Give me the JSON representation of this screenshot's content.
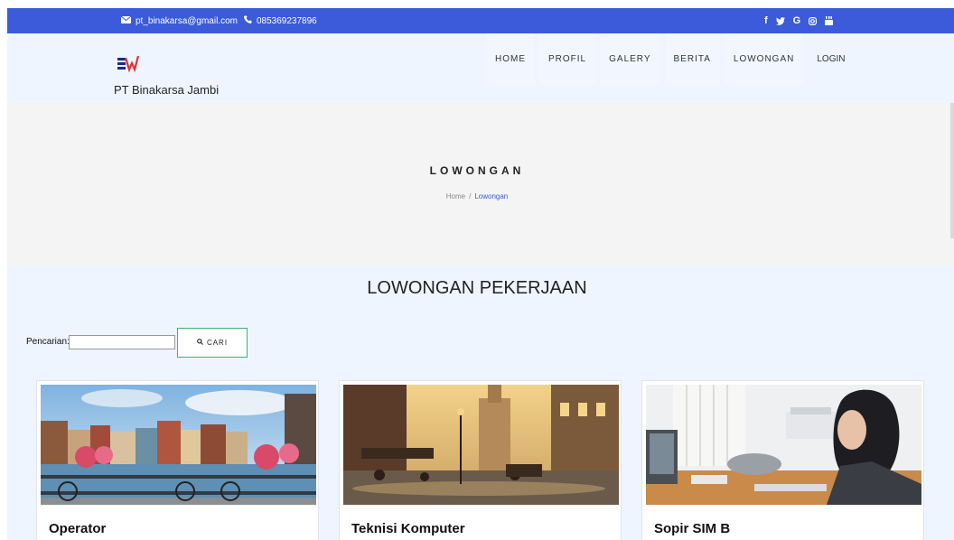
{
  "topbar": {
    "email": "pt_binakarsa@gmail.com",
    "phone": "085369237896",
    "social": [
      "f",
      "y",
      "G",
      "o",
      "yt"
    ]
  },
  "brand": {
    "name": "PT Binakarsa Jambi"
  },
  "nav": {
    "items": [
      "HOME",
      "PROFIL",
      "GALERY",
      "BERITA",
      "LOWONGAN",
      "LOGIN"
    ]
  },
  "banner": {
    "title": "LOWONGAN",
    "breadcrumb": [
      "Home",
      "Lowongan"
    ],
    "breadcrumb_sep": "/"
  },
  "section": {
    "title": "LOWONGAN PEKERJAAN"
  },
  "search": {
    "label": "Pencarian:",
    "value": "",
    "button": "CARI"
  },
  "jobs": [
    {
      "title": "Operator"
    },
    {
      "title": "Teknisi Komputer"
    },
    {
      "title": "Sopir SIM B"
    }
  ],
  "colors": {
    "accent": "#3b5bdb",
    "button_border": "#3cb371",
    "header_bg": "#eef5ff"
  }
}
